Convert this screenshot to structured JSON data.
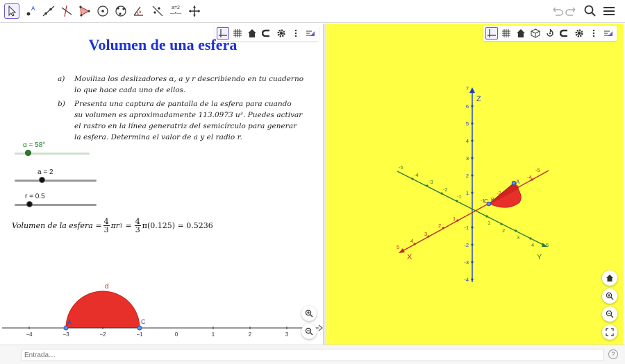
{
  "title": "Volumen de una esfera",
  "instructions": {
    "a_label": "a)",
    "a_lines": [
      "Moviliza los deslizadores α,  a  y  r describiendo en tu cuaderno",
      "lo que hace cada uno de ellos."
    ],
    "b_label": "b)",
    "b_lines": [
      "Presenta una captura de pantalla de la esfera para cuando",
      "su volumen es  aproximadamente 113.0973  u³. Puedes activar",
      "el rastro en la línea generatriz del semicírculo para generar",
      "la esfera. Determina el valor de a y el radio  r."
    ]
  },
  "sliders": {
    "alpha": {
      "label": "α = 58°",
      "value": 58,
      "min": 0,
      "max": 360,
      "color": "#1a7a1a"
    },
    "a": {
      "label": "a = 2",
      "value": 2,
      "min": -5,
      "max": 5
    },
    "r": {
      "label": "r = 0.5",
      "value": 0.5,
      "min": 0,
      "max": 5
    }
  },
  "formula": {
    "lhs": "Volumen de la esfera =",
    "frac_num": "4",
    "frac_den": "3",
    "pi_r3": "πr",
    "exp": "3",
    "eq": "=",
    "frac2_num": "4",
    "frac2_den": "3",
    "rhs": "π(0.125) = 0.5236"
  },
  "graph2d": {
    "x_ticks": [
      "−4",
      "−3",
      "−2",
      "−1",
      "0",
      "1",
      "2",
      "3"
    ],
    "point_a_label": "A",
    "point_c_label": "C",
    "arc_label": "d",
    "arc_color": "#e8302a"
  },
  "graph3d": {
    "background": "#ffff44",
    "z_label": "Z",
    "x_label": "X",
    "y_label": "Y",
    "z_ticks": [
      "7",
      "6",
      "5",
      "4",
      "3",
      "2",
      "1",
      "-1",
      "-2",
      "-3",
      "-4"
    ],
    "x_ticks_pos": [
      "1",
      "2",
      "3",
      "4",
      "5"
    ],
    "x_ticks_neg": [
      "-1",
      "-2",
      "-3",
      "-4",
      "-5"
    ],
    "y_ticks_pos": [
      "1",
      "2",
      "3",
      "4",
      "5"
    ],
    "y_ticks_neg": [
      "-1",
      "-2",
      "-3",
      "-4",
      "-5"
    ],
    "point_a_label": "A",
    "point_c_label": "C",
    "point_b_label": "B"
  },
  "input_bar": {
    "placeholder": "Entrada…",
    "help": "?"
  },
  "colors": {
    "accent": "#6557d2",
    "x_axis": "#c0282a",
    "y_axis": "#2e7d32",
    "z_axis": "#1f3fcf",
    "title": "#1f33d8"
  }
}
